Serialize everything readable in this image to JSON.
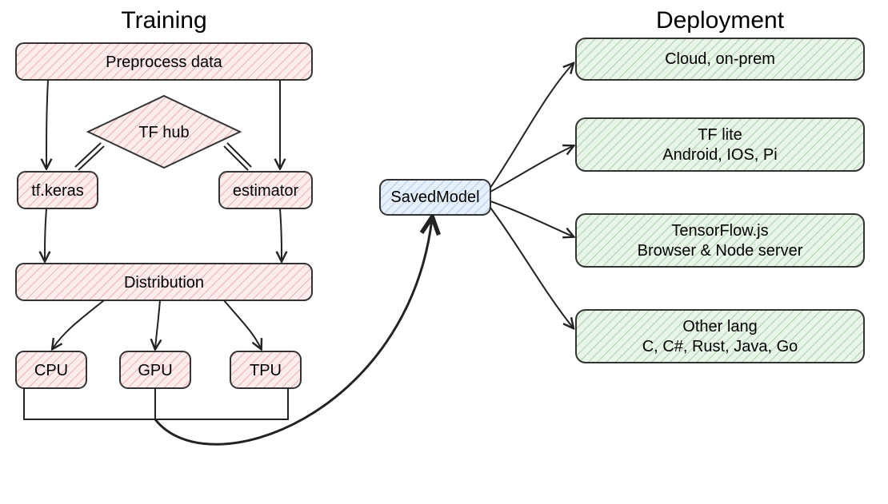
{
  "headings": {
    "training": "Training",
    "deployment": "Deployment"
  },
  "training": {
    "preprocess": "Preprocess data",
    "tfhub": "TF hub",
    "tfkeras": "tf.keras",
    "estimator": "estimator",
    "distribution": "Distribution",
    "cpu": "CPU",
    "gpu": "GPU",
    "tpu": "TPU"
  },
  "center": {
    "savedmodel": "SavedModel"
  },
  "deployment": {
    "cloud": {
      "line1": "Cloud, on-prem"
    },
    "tflite": {
      "line1": "TF lite",
      "line2": "Android, IOS, Pi"
    },
    "tfjs": {
      "line1": "TensorFlow.js",
      "line2": "Browser & Node server"
    },
    "other": {
      "line1": "Other lang",
      "line2": "C, C#, Rust, Java, Go"
    }
  },
  "colors": {
    "pink_fill": "#fdecec",
    "pink_stroke": "#d88",
    "blue_fill": "#e6f0fb",
    "blue_stroke": "#88aacc",
    "green_fill": "#e8f5e8",
    "green_stroke": "#6a9e6a",
    "line": "#222"
  }
}
